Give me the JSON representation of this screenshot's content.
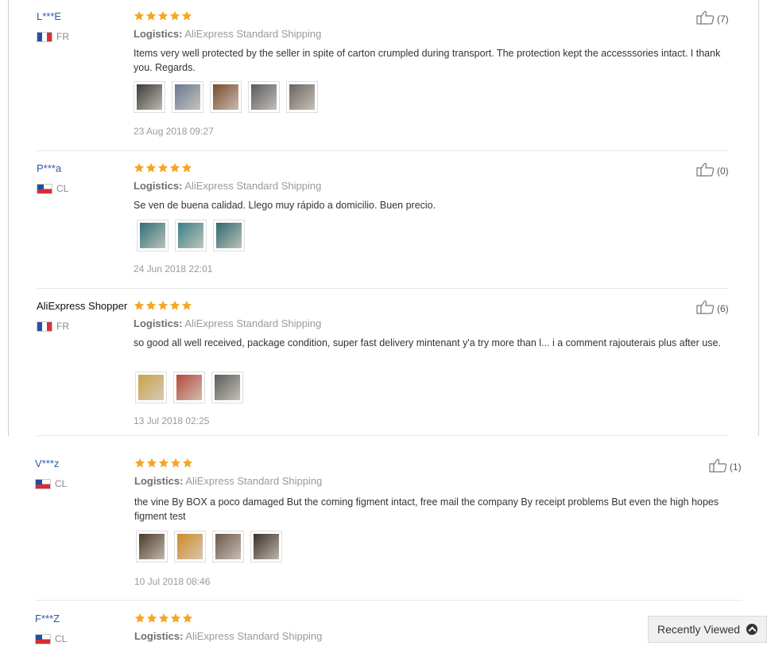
{
  "reviews": [
    {
      "user": "L***E",
      "country": "FR",
      "flag": "fr",
      "rating": 5,
      "logistics_label": "Logistics:",
      "shipping": "AliExpress Standard Shipping",
      "text": "Items very well protected by the seller in spite of carton crumpled during transport. The protection kept the accesssories intact. I thank you. Regards.",
      "photos": [
        "#3b3a38",
        "#6a7890",
        "#7a4a2e",
        "#5a5a62",
        "#6b6560"
      ],
      "date": "23 Aug 2018 09:27",
      "helpful": "(7)"
    },
    {
      "user": "P***a",
      "country": "CL",
      "flag": "cl",
      "rating": 5,
      "logistics_label": "Logistics:",
      "shipping": "AliExpress Standard Shipping",
      "text": "Se ven de buena calidad. Llego muy rápido a domicilio. Buen precio.",
      "photos": [
        "#2f6f78",
        "#3a7f86",
        "#2e6a70"
      ],
      "date": "24 Jun 2018 22:01",
      "helpful": "(0)"
    },
    {
      "user": "AliExpress Shopper",
      "country": "FR",
      "flag": "fr",
      "rating": 5,
      "logistics_label": "Logistics:",
      "shipping": "AliExpress Standard Shipping",
      "text": "so good all well received, package condition, super fast delivery mintenant y'a try more than l... i a comment rajouterais plus after use.",
      "photos": [
        "#c9a24a",
        "#b24a3a",
        "#5c5c5c"
      ],
      "date": "13 Jul 2018 02:25",
      "helpful": "(6)"
    },
    {
      "user": "V***z",
      "country": "CL",
      "flag": "cl",
      "rating": 5,
      "logistics_label": "Logistics:",
      "shipping": "AliExpress Standard Shipping",
      "text": "the vine By BOX a poco damaged But the coming figment intact, free mail the company By receipt problems But even the high hopes figment test",
      "photos": [
        "#4a3a2a",
        "#d08a28",
        "#6b5a4a",
        "#3a2e28"
      ],
      "date": "10 Jul 2018 08:46",
      "helpful": "(1)"
    },
    {
      "user": "F***Z",
      "country": "CL",
      "flag": "cl",
      "rating": 5,
      "logistics_label": "Logistics:",
      "shipping": "AliExpress Standard Shipping"
    }
  ],
  "recently_viewed": {
    "label": "Recently Viewed"
  },
  "colors": {
    "star": "#f5a623",
    "username": "#2a5aa7",
    "divider": "#e8e8e8"
  }
}
